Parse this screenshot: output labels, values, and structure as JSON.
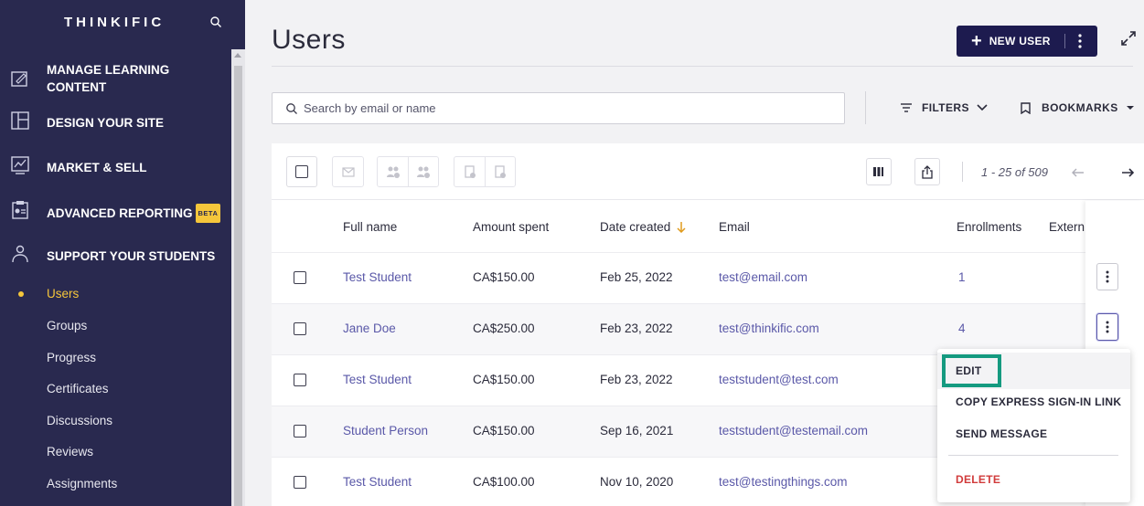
{
  "sidebar": {
    "logo": "THINKIFIC",
    "nav": [
      {
        "label_line1": "MANAGE LEARNING",
        "label_line2": "CONTENT",
        "icon": "edit-note-icon"
      },
      {
        "label": "DESIGN YOUR SITE",
        "icon": "layout-icon"
      },
      {
        "label": "MARKET & SELL",
        "icon": "chart-icon"
      },
      {
        "label": "ADVANCED REPORTING",
        "badge": "BETA",
        "icon": "report-icon"
      },
      {
        "label": "SUPPORT YOUR STUDENTS",
        "icon": "students-icon"
      }
    ],
    "sub_items": [
      "Users",
      "Groups",
      "Progress",
      "Certificates",
      "Discussions",
      "Reviews",
      "Assignments"
    ],
    "active_sub": "Users"
  },
  "header": {
    "title": "Users",
    "new_user_label": "NEW USER"
  },
  "search": {
    "placeholder": "Search by email or name"
  },
  "filters_label": "FILTERS",
  "bookmarks_label": "BOOKMARKS",
  "pager": {
    "range": "1 - 25 of 509"
  },
  "table": {
    "columns": [
      "Full name",
      "Amount spent",
      "Date created",
      "Email",
      "Enrollments",
      "Extern"
    ],
    "sort_column": "Date created",
    "rows": [
      {
        "name": "Test Student",
        "amount": "CA$150.00",
        "date": "Feb 25, 2022",
        "email": "test@email.com",
        "enrollments": "1"
      },
      {
        "name": "Jane Doe",
        "amount": "CA$250.00",
        "date": "Feb 23, 2022",
        "email": "test@thinkific.com",
        "enrollments": "4"
      },
      {
        "name": "Test Student",
        "amount": "CA$150.00",
        "date": "Feb 23, 2022",
        "email": "teststudent@test.com",
        "enrollments": ""
      },
      {
        "name": "Student Person",
        "amount": "CA$150.00",
        "date": "Sep 16, 2021",
        "email": "teststudent@testemail.com",
        "enrollments": ""
      },
      {
        "name": "Test Student",
        "amount": "CA$100.00",
        "date": "Nov 10, 2020",
        "email": "test@testingthings.com",
        "enrollments": ""
      }
    ]
  },
  "row_menu": {
    "items": [
      "EDIT",
      "COPY EXPRESS SIGN-IN LINK",
      "SEND MESSAGE",
      "DELETE"
    ],
    "highlighted": "EDIT",
    "danger_color": "#d13b3b"
  },
  "colors": {
    "sidebar_bg": "#29294f",
    "accent_yellow": "#f5c63b",
    "primary_button": "#1d1b4f",
    "link": "#5a58a8",
    "focus_ring": "#159a80"
  }
}
